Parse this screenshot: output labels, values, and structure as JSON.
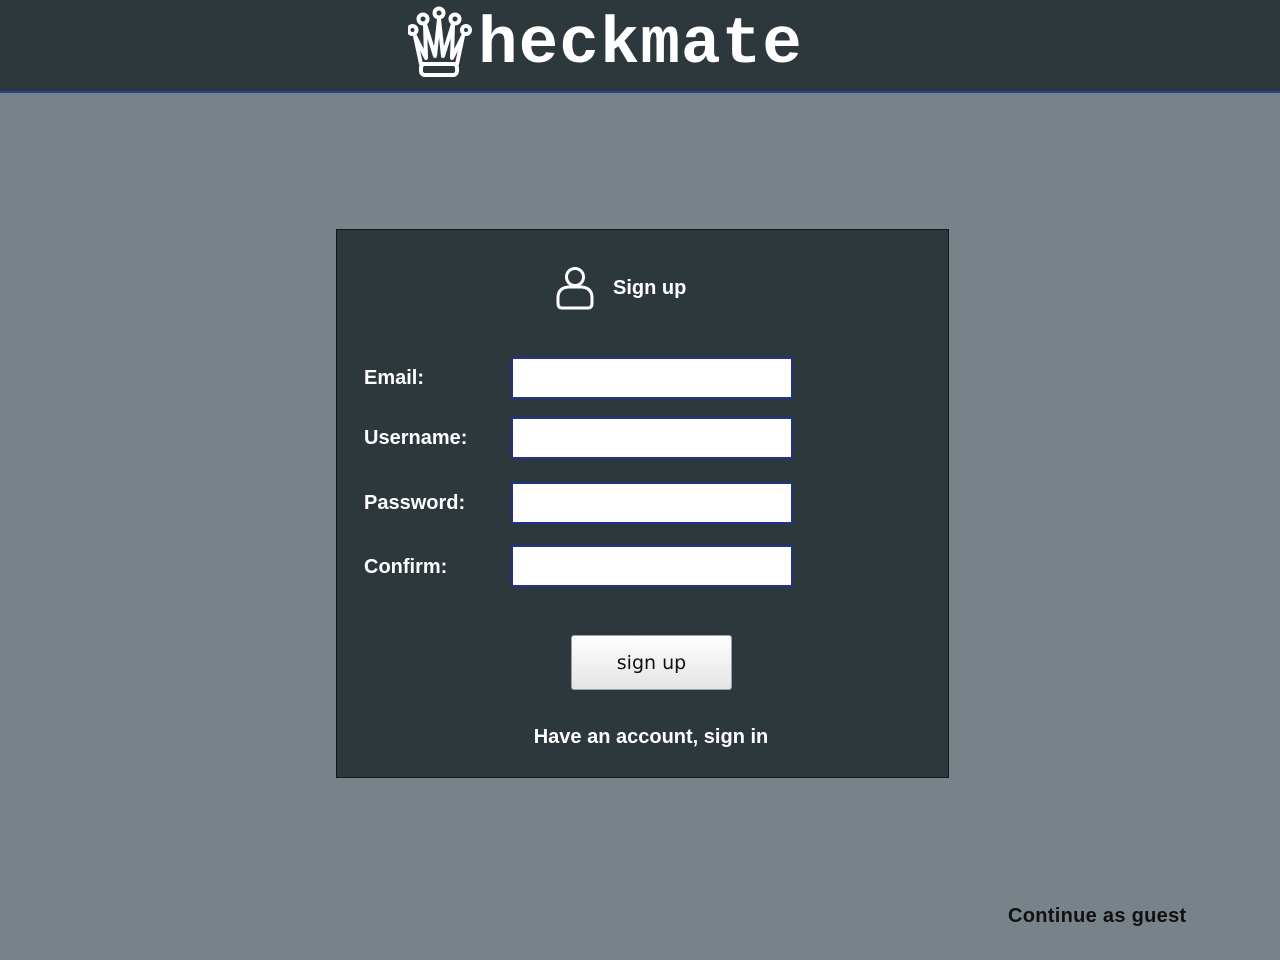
{
  "header": {
    "brand": "heckmate",
    "logo_icon": "queen-crown-icon"
  },
  "signup_form": {
    "title": "Sign up",
    "title_icon": "user-icon",
    "fields": [
      {
        "label": "Email:",
        "value": "",
        "placeholder": ""
      },
      {
        "label": "Username:",
        "value": "",
        "placeholder": ""
      },
      {
        "label": "Password:",
        "value": "",
        "placeholder": ""
      },
      {
        "label": "Confirm:",
        "value": "",
        "placeholder": ""
      }
    ],
    "submit_label": "sign up",
    "signin_link": "Have an account, sign in"
  },
  "guest_link": "Continue as guest",
  "colors": {
    "page_background": "#778389",
    "header_background": "#2d383d",
    "panel_background": "#2d383d",
    "input_border": "#23338a"
  }
}
